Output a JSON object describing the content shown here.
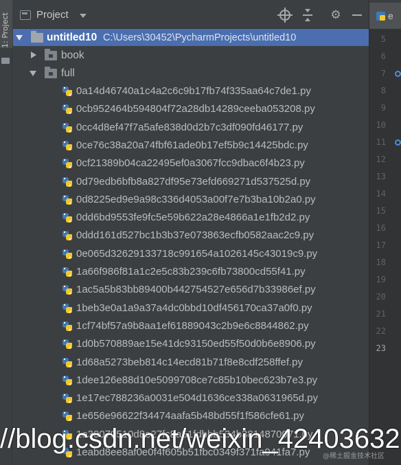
{
  "sidebar_strip": {
    "tab_label": "1: Project"
  },
  "header": {
    "title": "Project"
  },
  "tree": {
    "root": {
      "name": "untitled10",
      "path": "C:\\Users\\30452\\PycharmProjects\\untitled10"
    },
    "folders": [
      "book",
      "full"
    ],
    "files": [
      "0a14d46740a1c4a2c6c9b17fb74f335aa64c7de1.py",
      "0cb952464b594804f72a28db14289ceeba053208.py",
      "0cc4d8ef47f7a5afe838d0d2b7c3df090fd46177.py",
      "0ce76c38a20a74fbf61ade0b17ef5b9c14425bdc.py",
      "0cf21389b04ca22495ef0a3067fcc9dbac6f4b23.py",
      "0d79edb6bfb8a827df95e73efd669271d537525d.py",
      "0d8225ed9e9a98c336d4053a00f7e7b3ba10b2a0.py",
      "0dd6bd9553fe9fc5e59b622a28e4866a1e1fb2d2.py",
      "0ddd161d527bc1b3b37e073863ecfb0582aac2c9.py",
      "0e065d32629133718c991654a1026145c43019c9.py",
      "1a66f986f81a1c2e5c83b239c6fb73800cd55f41.py",
      "1ac5a5b83bb89400b442754527e656d7b33986ef.py",
      "1beb3e0a1a9a37a4dc0bbd10df456170ca37a0f0.py",
      "1cf74bf57a9b8aa1ef61889043c2b9e6c8844862.py",
      "1d0b570889ae15e41dc93150ed55f50d0b6e8906.py",
      "1d68a5273beb814c14ecd81b71f8e8cdf258ffef.py",
      "1dee126e88d10e5099708ce7c85b10bec623b7e3.py",
      "1e17ec788236a0031e504d1636ce338a0631965d.py",
      "1e656e96622f34474aafa5b48bd55f1f586cfe61.py",
      "1e30079510d8e27fc8a51fdbbb534b3814870071.py",
      "1eabd8ee8af0e0f4f605b51fbc0349f371fa041fa7.py"
    ]
  },
  "editor": {
    "tab_label": "e",
    "line_numbers": [
      "5",
      "6",
      "7",
      "8",
      "9",
      "10",
      "11",
      "12",
      "13",
      "14",
      "15",
      "16",
      "17",
      "18",
      "19",
      "20",
      "21",
      "22",
      "23"
    ],
    "current_line": "23",
    "breakpoint_lines": [
      "7",
      "11"
    ]
  },
  "watermark": {
    "text": "//blog.csdn.net/weixin_42403632",
    "brand": "@稀土掘金技术社区"
  },
  "colors": {
    "panel_bg": "#3c3f41",
    "selection": "#4b6eaf",
    "gutter_bg": "#313335",
    "text": "#bbbbbb"
  },
  "icons": [
    "project-window-icon",
    "locate-icon",
    "collapse-all-icon",
    "settings-gear-icon",
    "hide-minus-icon",
    "folder-icon",
    "python-file-icon",
    "expand-arrow-icon",
    "collapse-arrow-icon",
    "breakpoint-icon"
  ]
}
